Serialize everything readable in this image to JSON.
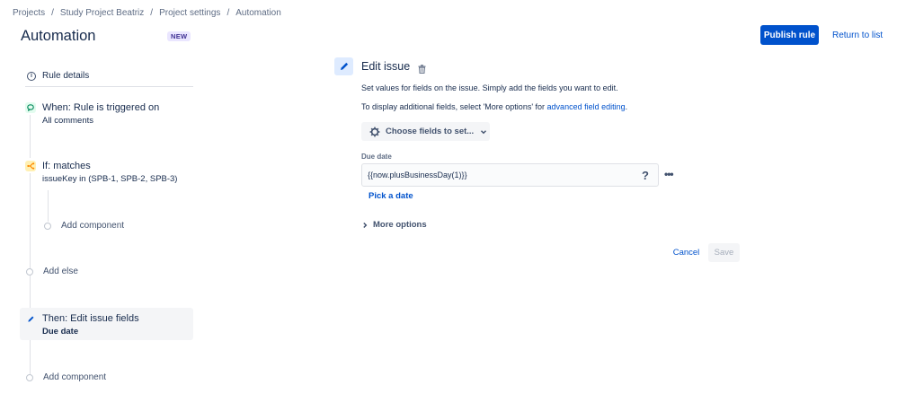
{
  "breadcrumb": {
    "items": [
      "Projects",
      "Study Project Beatriz",
      "Project settings",
      "Automation"
    ],
    "separator": "/"
  },
  "header": {
    "title": "Automation",
    "badge": "NEW",
    "publish_label": "Publish rule",
    "return_label": "Return to list"
  },
  "rule_panel": {
    "details_label": "Rule details",
    "trigger": {
      "title": "When: Rule is triggered on",
      "subtitle": "All comments",
      "icon": "comment-trigger-icon"
    },
    "condition": {
      "title": "If: matches",
      "subtitle": "issueKey in (SPB-1, SPB-2, SPB-3)",
      "icon": "branch-condition-icon"
    },
    "add_component_nested": "Add component",
    "add_else": "Add else",
    "action": {
      "title": "Then: Edit issue fields",
      "subtitle": "Due date",
      "icon": "pencil-icon"
    },
    "add_component": "Add component"
  },
  "editor": {
    "title": "Edit issue",
    "description": "Set values for fields on the issue. Simply add the fields you want to edit.",
    "additional_prefix": "To display additional fields, select 'More options' for ",
    "additional_link": "advanced field editing",
    "additional_suffix": ".",
    "choose_fields_label": "Choose fields to set...",
    "field": {
      "label": "Due date",
      "value": "{{now.plusBusinessDay(1)}}",
      "help": "?",
      "more": "•••",
      "pick_label": "Pick a date"
    },
    "more_options_label": "More options",
    "cancel_label": "Cancel",
    "save_label": "Save"
  },
  "colors": {
    "primary": "#0052cc",
    "text": "#172b4d",
    "subtle": "#5e6c84",
    "badge_bg": "#eae6ff",
    "trigger_bg": "#e3fcef",
    "trigger_fg": "#00875a",
    "condition_bg": "#fff0b3",
    "condition_fg": "#ff8b00",
    "action_bg": "#deebff"
  }
}
